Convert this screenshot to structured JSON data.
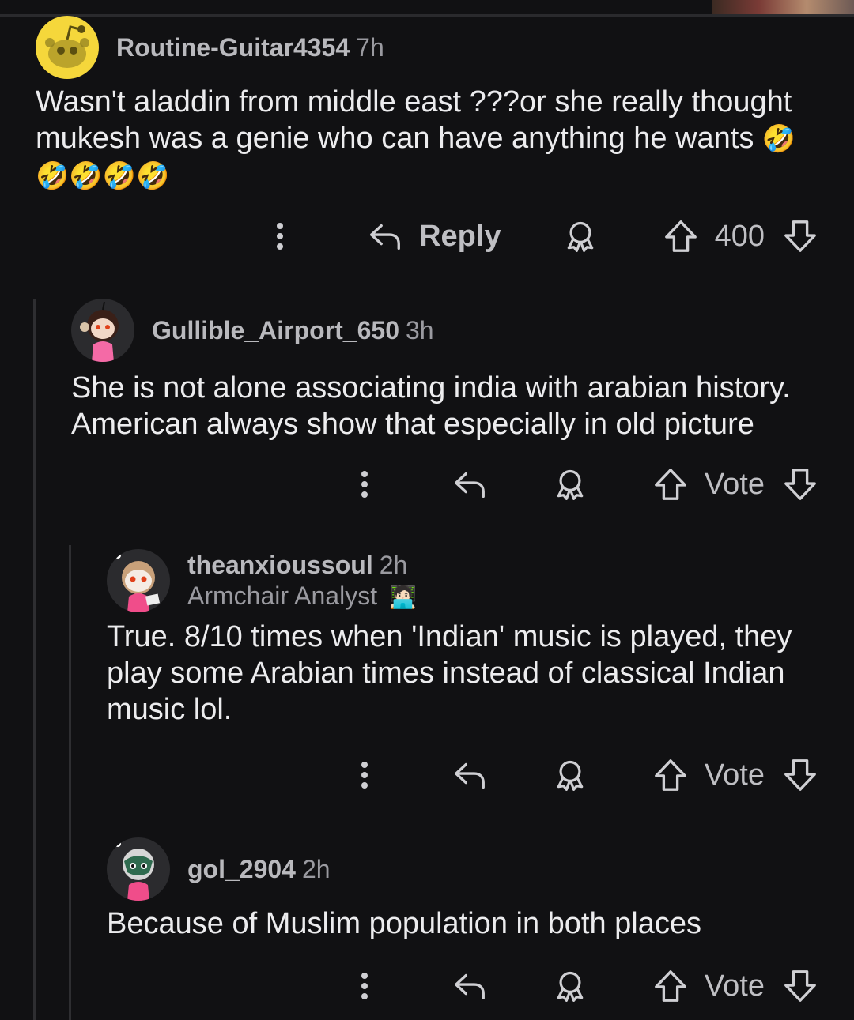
{
  "comments": [
    {
      "username": "Routine-Guitar4354",
      "time": "7h",
      "text": "Wasn't aladdin from middle east ???or she really thought mukesh was a genie who can have anything he wants",
      "emojis": "🤣🤣🤣🤣🤣",
      "reply_label": "Reply",
      "vote_label": "400"
    },
    {
      "username": "Gullible_Airport_650",
      "time": "3h",
      "text": "She is not alone associating india with arabian history. American always show that especially in old picture",
      "vote_label": "Vote"
    },
    {
      "username": "theanxioussoul",
      "time": "2h",
      "flair": "Armchair Analyst",
      "flair_emoji": "🧑🏻‍💻",
      "text": "True. 8/10 times when 'Indian' music is played, they play some Arabian times instead of classical Indian music lol.",
      "vote_label": "Vote"
    },
    {
      "username": "gol_2904",
      "time": "2h",
      "text": "Because of Muslim population in both places",
      "vote_label": "Vote"
    }
  ],
  "icons": [
    "more-icon",
    "reply-icon",
    "award-icon",
    "upvote-icon",
    "downvote-icon"
  ],
  "colors": {
    "background": "#111113",
    "text": "#ececee",
    "muted": "#9a9aa0"
  }
}
